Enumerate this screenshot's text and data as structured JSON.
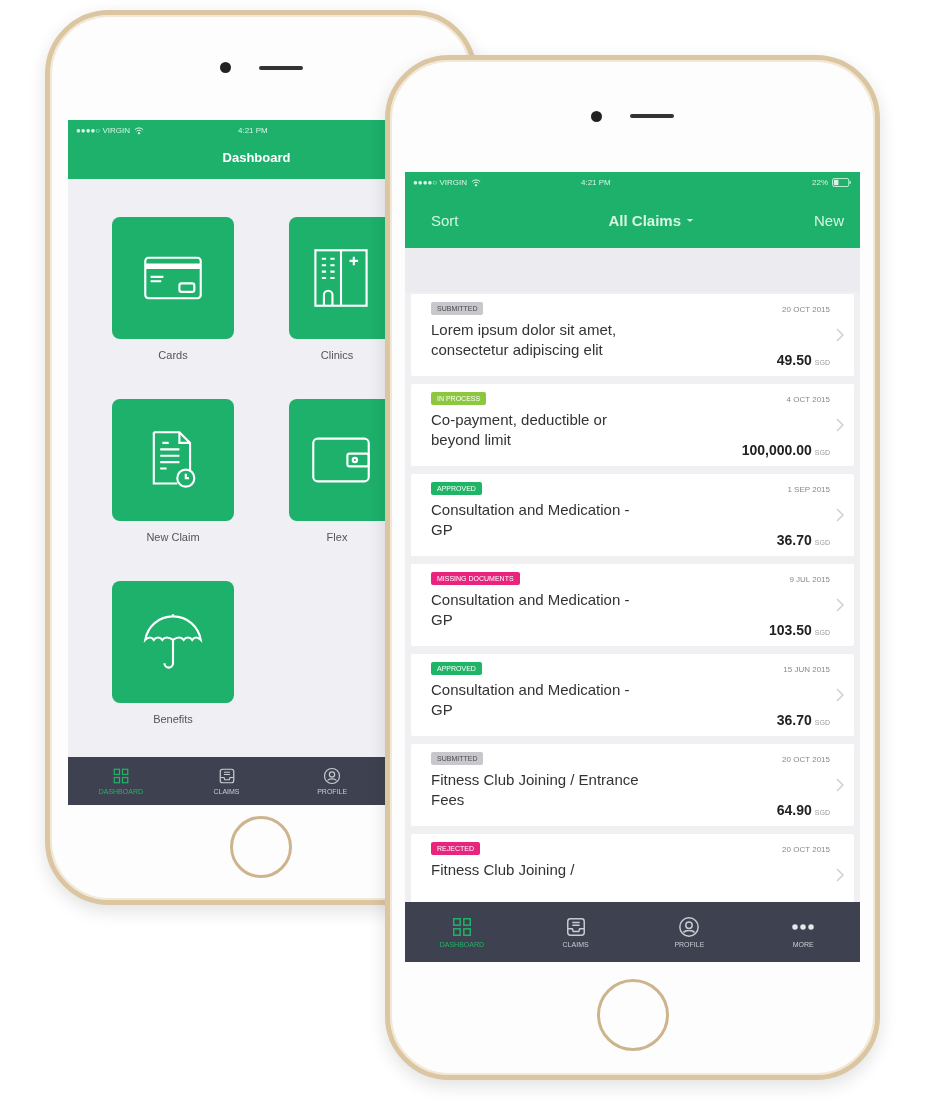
{
  "back_phone": {
    "status_bar": {
      "carrier": "●●●●○ VIRGIN",
      "time": "4:21 PM"
    },
    "title": "Dashboard",
    "tiles": [
      {
        "kind": "card",
        "label": "Cards"
      },
      {
        "kind": "clinic",
        "label": "Clinics"
      },
      {
        "kind": "claim",
        "label": "New Claim"
      },
      {
        "kind": "wallet",
        "label": "Flex"
      },
      {
        "kind": "umbrella",
        "label": "Benefits"
      }
    ],
    "tab_bar": [
      {
        "kind": "grid",
        "label": "DASHBOARD",
        "selected": true
      },
      {
        "kind": "claims",
        "label": "CLAIMS",
        "selected": false
      },
      {
        "kind": "profile",
        "label": "PROFILE",
        "selected": false
      }
    ]
  },
  "front_phone": {
    "status_bar": {
      "carrier": "●●●●○ VIRGIN",
      "time": "4:21 PM",
      "battery": "22%"
    },
    "nav": {
      "left": "Sort",
      "title": "All Claims",
      "right": "New"
    },
    "claims": [
      {
        "status": "SUBMITTED",
        "color": "#c8c8cc",
        "date": "20 OCT 2015",
        "title": "Lorem ipsum dolor sit amet, consectetur adipiscing elit",
        "amount": "49.50",
        "currency": "SGD"
      },
      {
        "status": "IN PROCESS",
        "color": "#8dc63f",
        "date": "4 OCT 2015",
        "title": "Co-payment, deductible or beyond limit",
        "amount": "100,000.00",
        "currency": "SGD"
      },
      {
        "status": "APPROVED",
        "color": "#1fb466",
        "date": "1 SEP 2015",
        "title": "Consultation and Medication - GP",
        "amount": "36.70",
        "currency": "SGD"
      },
      {
        "status": "MISSING DOCUMENTS",
        "color": "#e8247f",
        "date": "9 JUL 2015",
        "title": "Consultation and Medication - GP",
        "amount": "103.50",
        "currency": "SGD"
      },
      {
        "status": "APPROVED",
        "color": "#1fb466",
        "date": "15 JUN 2015",
        "title": "Consultation and Medication - GP",
        "amount": "36.70",
        "currency": "SGD"
      },
      {
        "status": "SUBMITTED",
        "color": "#c8c8cc",
        "date": "20 OCT 2015",
        "title": "Fitness Club Joining / Entrance Fees",
        "amount": "64.90",
        "currency": "SGD"
      },
      {
        "status": "REJECTED",
        "color": "#e8247f",
        "date": "20 OCT 2015",
        "title": "Fitness Club Joining /"
      }
    ],
    "tab_bar": [
      {
        "kind": "grid",
        "label": "DASHBOARD",
        "selected": true
      },
      {
        "kind": "claims",
        "label": "CLAIMS",
        "selected": false
      },
      {
        "kind": "profile",
        "label": "PROFILE",
        "selected": false
      },
      {
        "kind": "more",
        "label": "MORE",
        "selected": false
      }
    ]
  }
}
